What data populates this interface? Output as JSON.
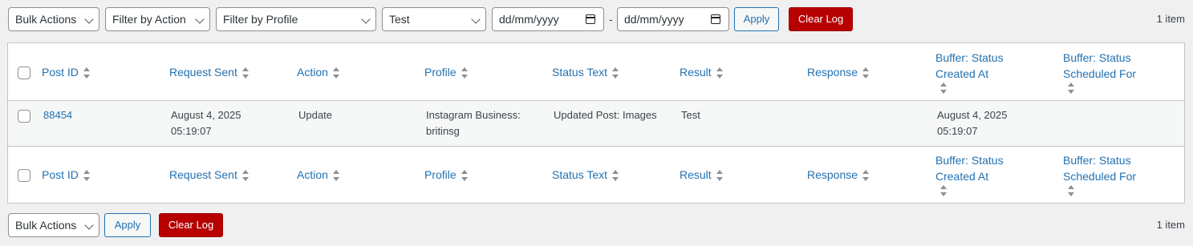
{
  "top_nav": {
    "bulk_actions": "Bulk Actions",
    "filter_action": "Filter by Action",
    "filter_profile": "Filter by Profile",
    "filter_test": "Test",
    "date_from": "dd/mm/yyyy",
    "date_sep": "-",
    "date_to": "dd/mm/yyyy",
    "apply": "Apply",
    "clear_log": "Clear Log",
    "count": "1 item"
  },
  "columns": {
    "post_id": "Post ID",
    "request_sent": "Request Sent",
    "action": "Action",
    "profile": "Profile",
    "status_text": "Status Text",
    "result": "Result",
    "response": "Response",
    "buffer_created": "Buffer: Status Created At",
    "buffer_scheduled": "Buffer: Status Scheduled For"
  },
  "rows": [
    {
      "post_id": "88454",
      "request_sent_date": "August 4, 2025",
      "request_sent_time": "05:19:07",
      "action": "Update",
      "profile_line1": "Instagram Business:",
      "profile_line2": "britinsg",
      "status_text": "Updated Post: Images",
      "result": "Test",
      "response": "",
      "buffer_created_date": "August 4, 2025",
      "buffer_created_time": "05:19:07",
      "buffer_scheduled": ""
    }
  ],
  "bottom_nav": {
    "bulk_actions": "Bulk Actions",
    "apply": "Apply",
    "clear_log": "Clear Log",
    "count": "1 item"
  },
  "colors": {
    "link": "#2271b1",
    "danger": "#b70000",
    "background": "#f0f0f1"
  }
}
